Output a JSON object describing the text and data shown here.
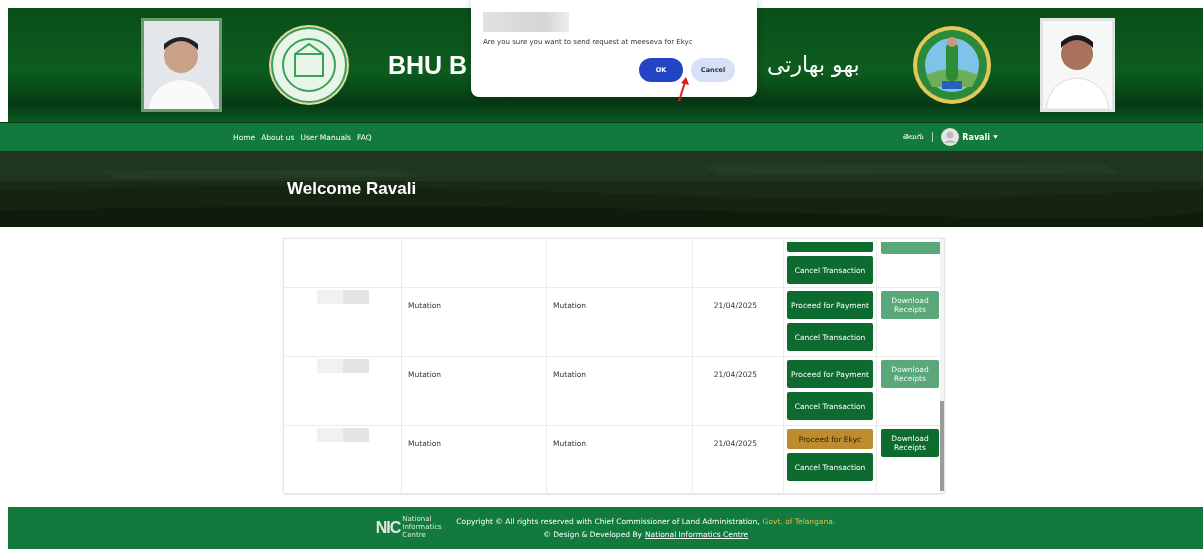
{
  "header": {
    "title": "BHU B",
    "title_urdu": "بهو بهارتی"
  },
  "dialog": {
    "message": "Are you sure you want to send request at meeseva for Ekyc",
    "buttons": [
      {
        "label": "OK",
        "kind": "primary"
      },
      {
        "label": "Cancel",
        "kind": "secondary"
      }
    ]
  },
  "nav": {
    "links": [
      "Home",
      "About us",
      "User Manuals",
      "FAQ"
    ],
    "language": "తెలుగు",
    "user": "Ravali"
  },
  "welcome": "Welcome Ravali",
  "table": {
    "rows": [
      {
        "kind": "partial",
        "cancel": "Cancel Transaction",
        "download_disabled": true
      },
      {
        "kind": "full",
        "column_2": "Mutation",
        "column_3": "Mutation",
        "date": "21/04/2025",
        "proceed": {
          "label": "Proceed for Payment",
          "kind": "payment"
        },
        "cancel": "Cancel Transaction",
        "download": {
          "label": "Download Receipts",
          "disabled": true
        }
      },
      {
        "kind": "full",
        "column_2": "Mutation",
        "column_3": "Mutation",
        "date": "21/04/2025",
        "proceed": {
          "label": "Proceed for Payment",
          "kind": "payment"
        },
        "cancel": "Cancel Transaction",
        "download": {
          "label": "Download Receipts",
          "disabled": true
        }
      },
      {
        "kind": "full",
        "column_2": "Mutation",
        "column_3": "Mutation",
        "date": "21/04/2025",
        "proceed": {
          "label": "Proceed for Ekyc",
          "kind": "ekyc"
        },
        "cancel": "Cancel Transaction",
        "download": {
          "label": "Download Receipts",
          "disabled": false
        }
      }
    ]
  },
  "footer": {
    "logo": "NIC",
    "logo_caption": "National Informatics Centre",
    "copyright": "Copyright © All rights reserved with Chief Commissioner of Land Administration,",
    "copyright_link": "Govt. of Telangana.",
    "design": "© Design & Developed By",
    "design_link": "National Informatics Centre"
  }
}
